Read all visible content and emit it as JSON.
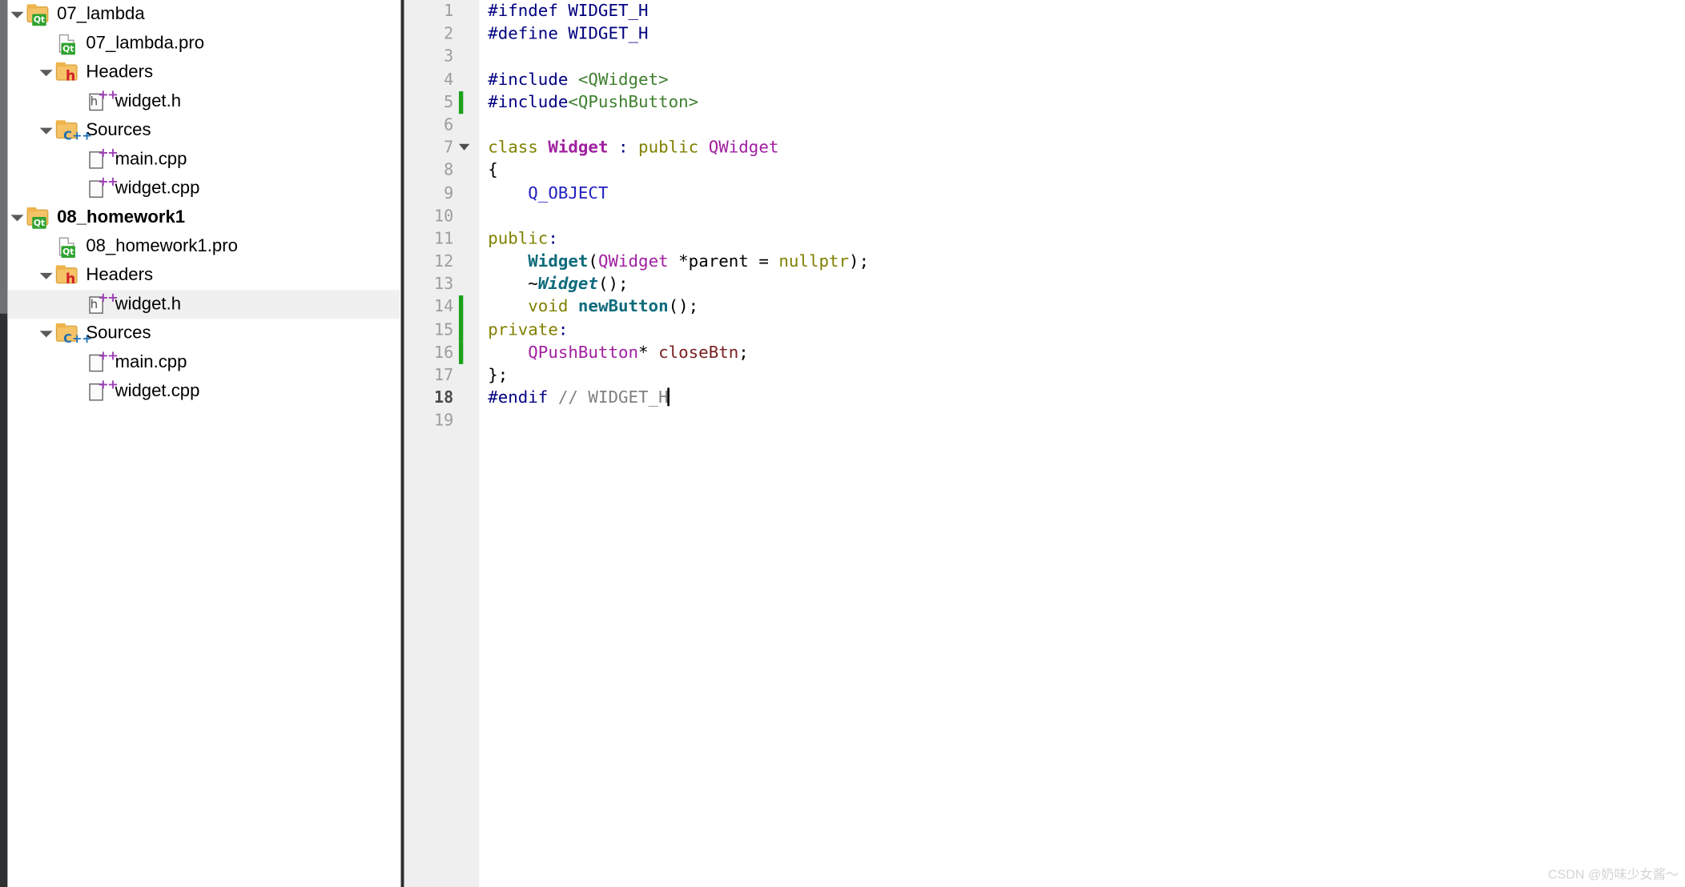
{
  "project_tree": {
    "name": "project-explorer",
    "items": [
      {
        "label": "07_lambda",
        "indent": 0,
        "twisty": "open",
        "icon": "qt-project-folder-icon",
        "bold": false,
        "selected": false
      },
      {
        "label": "07_lambda.pro",
        "indent": 1,
        "twisty": "none",
        "icon": "qt-pro-file-icon",
        "bold": false,
        "selected": false
      },
      {
        "label": "Headers",
        "indent": 1,
        "twisty": "open",
        "icon": "headers-folder-icon",
        "bold": false,
        "selected": false
      },
      {
        "label": "widget.h",
        "indent": 2,
        "twisty": "none",
        "icon": "cpp-header-file-icon",
        "bold": false,
        "selected": false
      },
      {
        "label": "Sources",
        "indent": 1,
        "twisty": "open",
        "icon": "sources-folder-icon",
        "bold": false,
        "selected": false
      },
      {
        "label": "main.cpp",
        "indent": 2,
        "twisty": "none",
        "icon": "cpp-source-file-icon",
        "bold": false,
        "selected": false
      },
      {
        "label": "widget.cpp",
        "indent": 2,
        "twisty": "none",
        "icon": "cpp-source-file-icon",
        "bold": false,
        "selected": false
      },
      {
        "label": "08_homework1",
        "indent": 0,
        "twisty": "open",
        "icon": "qt-project-folder-icon",
        "bold": true,
        "selected": false
      },
      {
        "label": "08_homework1.pro",
        "indent": 1,
        "twisty": "none",
        "icon": "qt-pro-file-icon",
        "bold": false,
        "selected": false
      },
      {
        "label": "Headers",
        "indent": 1,
        "twisty": "open",
        "icon": "headers-folder-icon",
        "bold": false,
        "selected": false
      },
      {
        "label": "widget.h",
        "indent": 2,
        "twisty": "none",
        "icon": "cpp-header-file-icon",
        "bold": false,
        "selected": true
      },
      {
        "label": "Sources",
        "indent": 1,
        "twisty": "open",
        "icon": "sources-folder-icon",
        "bold": false,
        "selected": false
      },
      {
        "label": "main.cpp",
        "indent": 2,
        "twisty": "none",
        "icon": "cpp-source-file-icon",
        "bold": false,
        "selected": false
      },
      {
        "label": "widget.cpp",
        "indent": 2,
        "twisty": "none",
        "icon": "cpp-source-file-icon",
        "bold": false,
        "selected": false
      }
    ]
  },
  "editor": {
    "language": "cpp",
    "cursor_line": 18,
    "total_lines": 19,
    "lines": [
      {
        "n": "1",
        "fold": false,
        "changed": false,
        "tokens": [
          {
            "t": "#ifndef ",
            "c": "t-pre"
          },
          {
            "t": "WIDGET_H",
            "c": "t-pre"
          }
        ]
      },
      {
        "n": "2",
        "fold": false,
        "changed": false,
        "tokens": [
          {
            "t": "#define ",
            "c": "t-pre"
          },
          {
            "t": "WIDGET_H",
            "c": "t-pre"
          }
        ]
      },
      {
        "n": "3",
        "fold": false,
        "changed": false,
        "tokens": []
      },
      {
        "n": "4",
        "fold": false,
        "changed": false,
        "tokens": [
          {
            "t": "#include ",
            "c": "t-pre"
          },
          {
            "t": "<QWidget>",
            "c": "t-inc"
          }
        ]
      },
      {
        "n": "5",
        "fold": false,
        "changed": true,
        "tokens": [
          {
            "t": "#include",
            "c": "t-pre"
          },
          {
            "t": "<QPushButton>",
            "c": "t-inc"
          }
        ]
      },
      {
        "n": "6",
        "fold": false,
        "changed": false,
        "tokens": []
      },
      {
        "n": "7",
        "fold": true,
        "changed": false,
        "tokens": [
          {
            "t": "class ",
            "c": "t-kw"
          },
          {
            "t": "Widget",
            "c": "t-type"
          },
          {
            "t": " : ",
            "c": "t-op"
          },
          {
            "t": "public ",
            "c": "t-kw"
          },
          {
            "t": "QWidget",
            "c": "t-qtype"
          }
        ]
      },
      {
        "n": "8",
        "fold": false,
        "changed": false,
        "tokens": [
          {
            "t": "{",
            "c": "t-plain"
          }
        ]
      },
      {
        "n": "9",
        "fold": false,
        "changed": false,
        "tokens": [
          {
            "t": "    ",
            "c": "t-plain"
          },
          {
            "t": "Q_OBJECT",
            "c": "t-macro"
          }
        ]
      },
      {
        "n": "10",
        "fold": false,
        "changed": false,
        "tokens": []
      },
      {
        "n": "11",
        "fold": false,
        "changed": false,
        "tokens": [
          {
            "t": "public",
            "c": "t-kw"
          },
          {
            "t": ":",
            "c": "t-op"
          }
        ]
      },
      {
        "n": "12",
        "fold": false,
        "changed": false,
        "tokens": [
          {
            "t": "    ",
            "c": "t-plain"
          },
          {
            "t": "Widget",
            "c": "t-func"
          },
          {
            "t": "(",
            "c": "t-plain"
          },
          {
            "t": "QWidget",
            "c": "t-qtype"
          },
          {
            "t": " *",
            "c": "t-plain"
          },
          {
            "t": "parent",
            "c": "t-var"
          },
          {
            "t": " = ",
            "c": "t-plain"
          },
          {
            "t": "nullptr",
            "c": "t-kw"
          },
          {
            "t": ");",
            "c": "t-plain"
          }
        ]
      },
      {
        "n": "13",
        "fold": false,
        "changed": false,
        "tokens": [
          {
            "t": "    ~",
            "c": "t-plain"
          },
          {
            "t": "Widget",
            "c": "t-funci"
          },
          {
            "t": "();",
            "c": "t-plain"
          }
        ]
      },
      {
        "n": "14",
        "fold": false,
        "changed": true,
        "tokens": [
          {
            "t": "    ",
            "c": "t-plain"
          },
          {
            "t": "void ",
            "c": "t-kw"
          },
          {
            "t": "newButton",
            "c": "t-func"
          },
          {
            "t": "();",
            "c": "t-plain"
          }
        ]
      },
      {
        "n": "15",
        "fold": false,
        "changed": true,
        "tokens": [
          {
            "t": "private",
            "c": "t-kw"
          },
          {
            "t": ":",
            "c": "t-op"
          }
        ]
      },
      {
        "n": "16",
        "fold": false,
        "changed": true,
        "tokens": [
          {
            "t": "    ",
            "c": "t-plain"
          },
          {
            "t": "QPushButton",
            "c": "t-qtype"
          },
          {
            "t": "* ",
            "c": "t-plain"
          },
          {
            "t": "closeBtn",
            "c": "t-field"
          },
          {
            "t": ";",
            "c": "t-plain"
          }
        ]
      },
      {
        "n": "17",
        "fold": false,
        "changed": false,
        "tokens": [
          {
            "t": "};",
            "c": "t-plain"
          }
        ]
      },
      {
        "n": "18",
        "fold": false,
        "changed": false,
        "current": true,
        "tokens": [
          {
            "t": "#endif ",
            "c": "t-pre"
          },
          {
            "t": "// WIDGET_H",
            "c": "t-cmt"
          }
        ]
      },
      {
        "n": "19",
        "fold": false,
        "changed": false,
        "tokens": []
      }
    ]
  },
  "watermark": {
    "text": "CSDN @奶味少女酱～"
  },
  "colors": {
    "selection_background": "#f0f0f0",
    "gutter_background": "#efefef",
    "gutter_text": "#9d9d9d",
    "change_marker_green": "#1aa21a",
    "rail_dark": "#2e2f30",
    "preprocessor_navy": "#000080",
    "include_green": "#3f7f2f",
    "keyword_olive": "#808000",
    "type_magenta": "#a020a0",
    "function_teal": "#0e6b7b",
    "macro_blue": "#2020c0",
    "member_maroon": "#7a2020",
    "comment_gray": "#808080"
  }
}
